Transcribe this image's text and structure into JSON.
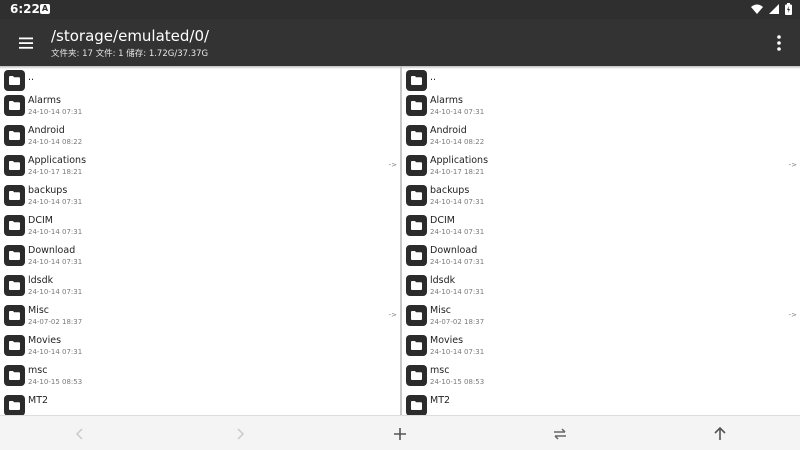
{
  "status": {
    "time": "6:22",
    "notification": "A"
  },
  "appbar": {
    "path": "/storage/emulated/0/",
    "info": "文件夹: 17  文件: 1  储存: 1.72G/37.37G"
  },
  "left_pane": {
    "parent_label": "..",
    "items": [
      {
        "name": "Alarms",
        "date": "24-10-14 07:31",
        "link": ""
      },
      {
        "name": "Android",
        "date": "24-10-14 08:22",
        "link": ""
      },
      {
        "name": "Applications",
        "date": "24-10-17 18:21",
        "link": "->"
      },
      {
        "name": "backups",
        "date": "24-10-14 07:31",
        "link": ""
      },
      {
        "name": "DCIM",
        "date": "24-10-14 07:31",
        "link": ""
      },
      {
        "name": "Download",
        "date": "24-10-14 07:31",
        "link": ""
      },
      {
        "name": "ldsdk",
        "date": "24-10-14 07:31",
        "link": ""
      },
      {
        "name": "Misc",
        "date": "24-07-02 18:37",
        "link": "->"
      },
      {
        "name": "Movies",
        "date": "24-10-14 07:31",
        "link": ""
      },
      {
        "name": "msc",
        "date": "24-10-15 08:53",
        "link": ""
      },
      {
        "name": "MT2",
        "date": "",
        "link": ""
      }
    ]
  },
  "right_pane": {
    "parent_label": "..",
    "items": [
      {
        "name": "Alarms",
        "date": "24-10-14 07:31",
        "link": ""
      },
      {
        "name": "Android",
        "date": "24-10-14 08:22",
        "link": ""
      },
      {
        "name": "Applications",
        "date": "24-10-17 18:21",
        "link": "->"
      },
      {
        "name": "backups",
        "date": "24-10-14 07:31",
        "link": ""
      },
      {
        "name": "DCIM",
        "date": "24-10-14 07:31",
        "link": ""
      },
      {
        "name": "Download",
        "date": "24-10-14 07:31",
        "link": ""
      },
      {
        "name": "ldsdk",
        "date": "24-10-14 07:31",
        "link": ""
      },
      {
        "name": "Misc",
        "date": "24-07-02 18:37",
        "link": "->"
      },
      {
        "name": "Movies",
        "date": "24-10-14 07:31",
        "link": ""
      },
      {
        "name": "msc",
        "date": "24-10-15 08:53",
        "link": ""
      },
      {
        "name": "MT2",
        "date": "",
        "link": ""
      }
    ]
  },
  "bottombar": {
    "icons": [
      "back-icon",
      "forward-icon",
      "add-icon",
      "swap-icon",
      "up-icon"
    ]
  },
  "colors": {
    "appbar": "#333333",
    "statusbar": "#2f2f2f",
    "folder_icon": "#2b2b2b"
  }
}
